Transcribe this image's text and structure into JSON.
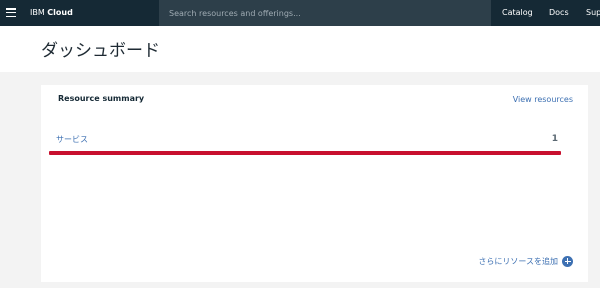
{
  "header": {
    "brand_prefix": "IBM",
    "brand_name": "Cloud",
    "search_placeholder": "Search resources and offerings...",
    "search_value": "",
    "nav": [
      "Catalog",
      "Docs",
      "Sup"
    ],
    "colors": {
      "topbar": "#152935",
      "search_bg": "#2d3f4a"
    }
  },
  "page": {
    "title": "ダッシュボード"
  },
  "resource_summary": {
    "title": "Resource summary",
    "view_link": "View resources",
    "service_label": "サービス",
    "service_count": "1",
    "add_label": "さらにリソースを追加",
    "colors": {
      "link": "#3d70b2",
      "highlight": "#c8102e"
    }
  },
  "icons": [
    "menu-icon",
    "search-icon",
    "add-circle-icon"
  ]
}
